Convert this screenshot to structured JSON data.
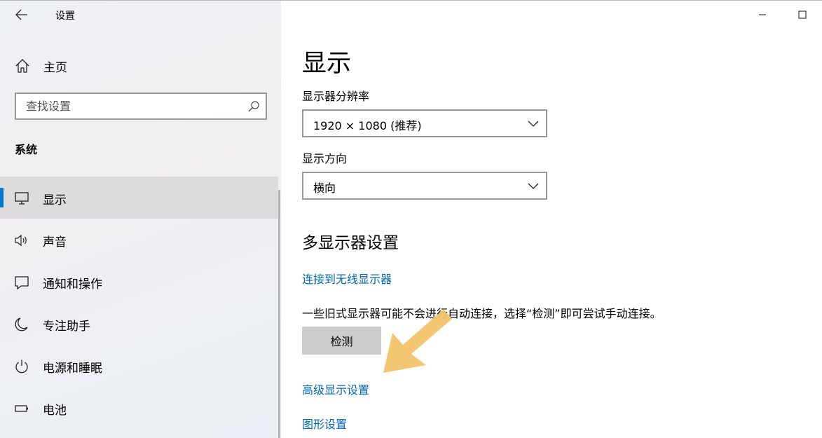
{
  "window": {
    "title": "设置",
    "controls": [
      "minimize-icon",
      "maximize-icon"
    ]
  },
  "sidebar": {
    "back_icon": "back-arrow-icon",
    "home": {
      "label": "主页",
      "icon": "home-icon"
    },
    "search": {
      "placeholder": "查找设置",
      "icon": "search-icon"
    },
    "section_title": "系统",
    "items": [
      {
        "label": "显示",
        "icon": "monitor-icon",
        "selected": true
      },
      {
        "label": "声音",
        "icon": "speaker-icon",
        "selected": false
      },
      {
        "label": "通知和操作",
        "icon": "notification-icon",
        "selected": false
      },
      {
        "label": "专注助手",
        "icon": "moon-icon",
        "selected": false
      },
      {
        "label": "电源和睡眠",
        "icon": "power-icon",
        "selected": false
      },
      {
        "label": "电池",
        "icon": "battery-icon",
        "selected": false
      }
    ],
    "accent_color": "#0078d7"
  },
  "main": {
    "title": "显示",
    "resolution": {
      "label": "显示器分辨率",
      "value": "1920 × 1080 (推荐)"
    },
    "orientation": {
      "label": "显示方向",
      "value": "横向"
    },
    "multi_display": {
      "heading": "多显示器设置",
      "wireless_link": "连接到无线显示器",
      "description": "一些旧式显示器可能不会进行自动连接，选择“检测”即可尝试手动连接。",
      "detect_button": "检测",
      "advanced_link": "高级显示设置",
      "graphics_link": "图形设置"
    },
    "link_color": "#0067b8",
    "annotation_arrow_color": "#f2c46a"
  }
}
